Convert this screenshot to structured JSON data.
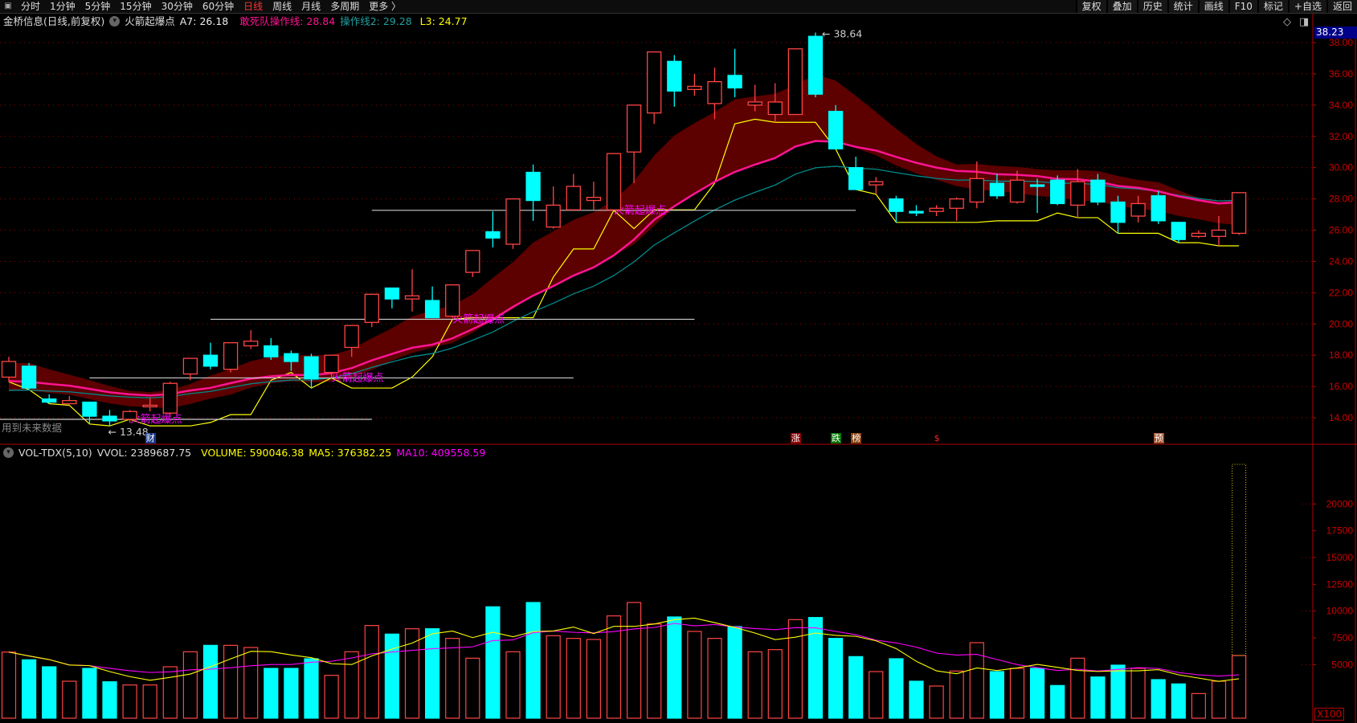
{
  "menu": {
    "items": [
      "分时",
      "1分钟",
      "5分钟",
      "15分钟",
      "30分钟",
      "60分钟",
      "日线",
      "周线",
      "月线",
      "多周期",
      "更多 〉"
    ],
    "active": "日线",
    "right_buttons": [
      "复权",
      "叠加",
      "历史",
      "统计",
      "画线",
      "F10",
      "标记",
      "+自选",
      "返回"
    ]
  },
  "info": {
    "title": "金桥信息(日线,前复权)",
    "indicator": "火箭起爆点",
    "a7": "A7: 26.18",
    "line1": "敢死队操作线: 28.84",
    "line2": "操作线2: 29.28",
    "l3": "L3: 24.77"
  },
  "vol_info": {
    "name": "VOL-TDX(5,10)",
    "vvol": "VVOL: 2389687.75",
    "volume": "VOLUME: 590046.38",
    "ma5": "MA5: 376382.25",
    "ma10": "MA10: 409558.59"
  },
  "last_price": "38.23",
  "future_data_note": "用到未来数据",
  "vol_unit": "X100",
  "colors": {
    "up": "#ff4444",
    "down": "#00ffff",
    "band": "#5c0000",
    "line1": "#ff1493",
    "line2": "#008b8b",
    "l3": "#ffff00",
    "signal": "#ff00ff",
    "ma5": "#ffff00",
    "ma10": "#ff00ff",
    "grid": "#990000"
  },
  "chart_data": {
    "type": "candlestick",
    "price_axis": {
      "ticks": [
        "14.00",
        "16.00",
        "18.00",
        "20.00",
        "22.00",
        "24.00",
        "26.00",
        "28.00",
        "30.00",
        "32.00",
        "34.00",
        "36.00",
        "38.00"
      ],
      "range": [
        13.2,
        39
      ]
    },
    "volume_axis": {
      "ticks": [
        "5000",
        "7500",
        "10000",
        "12500",
        "15000",
        "17500",
        "20000"
      ],
      "unit": "X100"
    },
    "ohlc": [
      [
        16.6,
        17.6,
        17.9,
        16.3
      ],
      [
        17.3,
        15.9,
        17.5,
        15.8
      ],
      [
        15.2,
        15.0,
        15.5,
        14.9
      ],
      [
        14.9,
        15.1,
        15.4,
        14.8
      ],
      [
        15.0,
        14.1,
        15.0,
        13.6
      ],
      [
        14.1,
        13.8,
        14.5,
        13.48
      ],
      [
        13.9,
        14.4,
        14.5,
        13.7
      ],
      [
        14.7,
        14.8,
        15.3,
        14.4
      ],
      [
        14.3,
        16.2,
        16.3,
        14.2
      ],
      [
        16.8,
        17.8,
        17.8,
        16.4
      ],
      [
        18.0,
        17.3,
        18.8,
        17.1
      ],
      [
        17.1,
        18.8,
        18.8,
        16.9
      ],
      [
        18.6,
        18.9,
        19.6,
        18.4
      ],
      [
        18.6,
        17.9,
        19.1,
        17.7
      ],
      [
        18.1,
        17.6,
        18.3,
        17.0
      ],
      [
        17.9,
        16.5,
        18.1,
        15.9
      ],
      [
        16.9,
        18.0,
        18.0,
        16.6
      ],
      [
        18.5,
        19.9,
        19.9,
        17.9
      ],
      [
        20.1,
        21.9,
        21.9,
        19.8
      ],
      [
        22.3,
        21.6,
        22.3,
        21.0
      ],
      [
        21.6,
        21.8,
        23.5,
        20.8
      ],
      [
        21.5,
        20.4,
        22.4,
        20.4
      ],
      [
        20.5,
        22.5,
        22.5,
        20.4
      ],
      [
        23.3,
        24.7,
        24.7,
        23.0
      ],
      [
        25.9,
        25.5,
        27.2,
        24.9
      ],
      [
        25.1,
        28.0,
        28.0,
        24.8
      ],
      [
        29.7,
        27.9,
        30.2,
        26.6
      ],
      [
        26.2,
        27.6,
        28.8,
        26.1
      ],
      [
        27.3,
        28.8,
        29.6,
        27.3
      ],
      [
        27.9,
        28.1,
        29.1,
        27.3
      ],
      [
        27.3,
        30.9,
        30.9,
        27.3
      ],
      [
        31.0,
        34.0,
        34.0,
        29.0
      ],
      [
        33.5,
        37.4,
        37.4,
        32.8
      ],
      [
        36.8,
        34.9,
        37.2,
        33.9
      ],
      [
        35.0,
        35.2,
        36.0,
        34.6
      ],
      [
        34.1,
        35.5,
        36.4,
        33.1
      ],
      [
        35.9,
        35.1,
        37.6,
        34.5
      ],
      [
        34.0,
        34.2,
        35.3,
        33.6
      ],
      [
        33.4,
        34.2,
        35.4,
        32.9
      ],
      [
        33.4,
        37.6,
        37.6,
        33.4
      ],
      [
        38.4,
        34.7,
        38.64,
        34.5
      ],
      [
        33.6,
        31.2,
        34.0,
        31.2
      ],
      [
        30.0,
        28.6,
        30.7,
        28.6
      ],
      [
        28.9,
        29.1,
        29.4,
        28.3
      ],
      [
        28.0,
        27.2,
        28.2,
        26.5
      ],
      [
        27.2,
        27.1,
        27.6,
        26.9
      ],
      [
        27.2,
        27.4,
        27.6,
        26.9
      ],
      [
        27.4,
        28.0,
        28.1,
        26.6
      ],
      [
        27.8,
        29.3,
        30.4,
        27.4
      ],
      [
        29.0,
        28.2,
        29.6,
        28.0
      ],
      [
        27.8,
        29.2,
        29.8,
        27.7
      ],
      [
        28.9,
        28.8,
        29.3,
        27.1
      ],
      [
        29.2,
        27.7,
        29.5,
        27.6
      ],
      [
        27.6,
        29.1,
        29.9,
        26.8
      ],
      [
        29.2,
        27.8,
        29.6,
        27.6
      ],
      [
        27.8,
        26.5,
        28.2,
        25.8
      ],
      [
        26.9,
        27.7,
        28.2,
        26.5
      ],
      [
        28.2,
        26.6,
        28.5,
        26.4
      ],
      [
        26.5,
        25.4,
        26.5,
        25.2
      ],
      [
        25.6,
        25.8,
        26.0,
        25.5
      ],
      [
        25.6,
        26.0,
        26.9,
        25.0
      ],
      [
        25.8,
        28.4,
        28.4,
        25.7
      ]
    ],
    "volume": [
      6170,
      5450,
      4800,
      3450,
      4650,
      3400,
      3100,
      3100,
      4800,
      6200,
      6800,
      6800,
      6600,
      4650,
      4650,
      5550,
      4000,
      6200,
      8650,
      7850,
      8350,
      8350,
      7450,
      5600,
      10400,
      6200,
      10800,
      7700,
      7450,
      7350,
      9550,
      10800,
      8800,
      9450,
      8100,
      7450,
      8550,
      6200,
      6400,
      9200,
      9400,
      7450,
      5750,
      4350,
      5550,
      3450,
      3000,
      4400,
      7050,
      4350,
      4650,
      4650,
      3050,
      5600,
      3850,
      4950,
      4650,
      3600,
      3200,
      2300,
      3450,
      5850
    ],
    "volume_projected_last": 23700,
    "high_label": "38.64",
    "low_label": "13.48",
    "signal_label": "火箭起爆点",
    "signals": [
      {
        "index": 6,
        "level": 13.9,
        "from": 0,
        "to": 18
      },
      {
        "index": 16,
        "level": 16.55,
        "from": 4,
        "to": 28
      },
      {
        "index": 22,
        "level": 20.3,
        "from": 10,
        "to": 34
      },
      {
        "index": 30,
        "level": 27.27,
        "from": 18,
        "to": 42
      }
    ],
    "markers": [
      {
        "index": 7,
        "text": "财",
        "bg": "#1a3a8a",
        "fg": "#fff"
      },
      {
        "index": 39,
        "text": "涨",
        "bg": "#8b0000",
        "fg": "#fff"
      },
      {
        "index": 41,
        "text": "跌",
        "bg": "#007700",
        "fg": "#fff"
      },
      {
        "index": 42,
        "text": "榜",
        "bg": "#8b4513",
        "fg": "#fff"
      },
      {
        "index": 46,
        "text": "$",
        "bg": "transparent",
        "fg": "#ff2222"
      },
      {
        "index": 57,
        "text": "预",
        "bg": "#a0522d",
        "fg": "#fff"
      }
    ]
  }
}
